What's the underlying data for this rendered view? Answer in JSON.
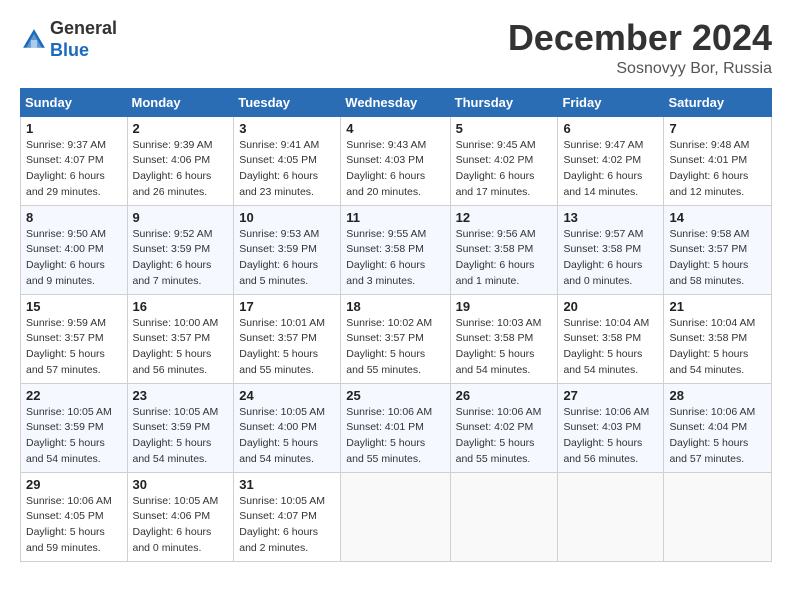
{
  "logo": {
    "general": "General",
    "blue": "Blue"
  },
  "header": {
    "title": "December 2024",
    "location": "Sosnovyy Bor, Russia"
  },
  "weekdays": [
    "Sunday",
    "Monday",
    "Tuesday",
    "Wednesday",
    "Thursday",
    "Friday",
    "Saturday"
  ],
  "weeks": [
    [
      {
        "day": "1",
        "sunrise": "9:37 AM",
        "sunset": "4:07 PM",
        "daylight": "6 hours and 29 minutes."
      },
      {
        "day": "2",
        "sunrise": "9:39 AM",
        "sunset": "4:06 PM",
        "daylight": "6 hours and 26 minutes."
      },
      {
        "day": "3",
        "sunrise": "9:41 AM",
        "sunset": "4:05 PM",
        "daylight": "6 hours and 23 minutes."
      },
      {
        "day": "4",
        "sunrise": "9:43 AM",
        "sunset": "4:03 PM",
        "daylight": "6 hours and 20 minutes."
      },
      {
        "day": "5",
        "sunrise": "9:45 AM",
        "sunset": "4:02 PM",
        "daylight": "6 hours and 17 minutes."
      },
      {
        "day": "6",
        "sunrise": "9:47 AM",
        "sunset": "4:02 PM",
        "daylight": "6 hours and 14 minutes."
      },
      {
        "day": "7",
        "sunrise": "9:48 AM",
        "sunset": "4:01 PM",
        "daylight": "6 hours and 12 minutes."
      }
    ],
    [
      {
        "day": "8",
        "sunrise": "9:50 AM",
        "sunset": "4:00 PM",
        "daylight": "6 hours and 9 minutes."
      },
      {
        "day": "9",
        "sunrise": "9:52 AM",
        "sunset": "3:59 PM",
        "daylight": "6 hours and 7 minutes."
      },
      {
        "day": "10",
        "sunrise": "9:53 AM",
        "sunset": "3:59 PM",
        "daylight": "6 hours and 5 minutes."
      },
      {
        "day": "11",
        "sunrise": "9:55 AM",
        "sunset": "3:58 PM",
        "daylight": "6 hours and 3 minutes."
      },
      {
        "day": "12",
        "sunrise": "9:56 AM",
        "sunset": "3:58 PM",
        "daylight": "6 hours and 1 minute."
      },
      {
        "day": "13",
        "sunrise": "9:57 AM",
        "sunset": "3:58 PM",
        "daylight": "6 hours and 0 minutes."
      },
      {
        "day": "14",
        "sunrise": "9:58 AM",
        "sunset": "3:57 PM",
        "daylight": "5 hours and 58 minutes."
      }
    ],
    [
      {
        "day": "15",
        "sunrise": "9:59 AM",
        "sunset": "3:57 PM",
        "daylight": "5 hours and 57 minutes."
      },
      {
        "day": "16",
        "sunrise": "10:00 AM",
        "sunset": "3:57 PM",
        "daylight": "5 hours and 56 minutes."
      },
      {
        "day": "17",
        "sunrise": "10:01 AM",
        "sunset": "3:57 PM",
        "daylight": "5 hours and 55 minutes."
      },
      {
        "day": "18",
        "sunrise": "10:02 AM",
        "sunset": "3:57 PM",
        "daylight": "5 hours and 55 minutes."
      },
      {
        "day": "19",
        "sunrise": "10:03 AM",
        "sunset": "3:58 PM",
        "daylight": "5 hours and 54 minutes."
      },
      {
        "day": "20",
        "sunrise": "10:04 AM",
        "sunset": "3:58 PM",
        "daylight": "5 hours and 54 minutes."
      },
      {
        "day": "21",
        "sunrise": "10:04 AM",
        "sunset": "3:58 PM",
        "daylight": "5 hours and 54 minutes."
      }
    ],
    [
      {
        "day": "22",
        "sunrise": "10:05 AM",
        "sunset": "3:59 PM",
        "daylight": "5 hours and 54 minutes."
      },
      {
        "day": "23",
        "sunrise": "10:05 AM",
        "sunset": "3:59 PM",
        "daylight": "5 hours and 54 minutes."
      },
      {
        "day": "24",
        "sunrise": "10:05 AM",
        "sunset": "4:00 PM",
        "daylight": "5 hours and 54 minutes."
      },
      {
        "day": "25",
        "sunrise": "10:06 AM",
        "sunset": "4:01 PM",
        "daylight": "5 hours and 55 minutes."
      },
      {
        "day": "26",
        "sunrise": "10:06 AM",
        "sunset": "4:02 PM",
        "daylight": "5 hours and 55 minutes."
      },
      {
        "day": "27",
        "sunrise": "10:06 AM",
        "sunset": "4:03 PM",
        "daylight": "5 hours and 56 minutes."
      },
      {
        "day": "28",
        "sunrise": "10:06 AM",
        "sunset": "4:04 PM",
        "daylight": "5 hours and 57 minutes."
      }
    ],
    [
      {
        "day": "29",
        "sunrise": "10:06 AM",
        "sunset": "4:05 PM",
        "daylight": "5 hours and 59 minutes."
      },
      {
        "day": "30",
        "sunrise": "10:05 AM",
        "sunset": "4:06 PM",
        "daylight": "6 hours and 0 minutes."
      },
      {
        "day": "31",
        "sunrise": "10:05 AM",
        "sunset": "4:07 PM",
        "daylight": "6 hours and 2 minutes."
      },
      null,
      null,
      null,
      null
    ]
  ],
  "labels": {
    "sunrise": "Sunrise:",
    "sunset": "Sunset:",
    "daylight": "Daylight:"
  }
}
